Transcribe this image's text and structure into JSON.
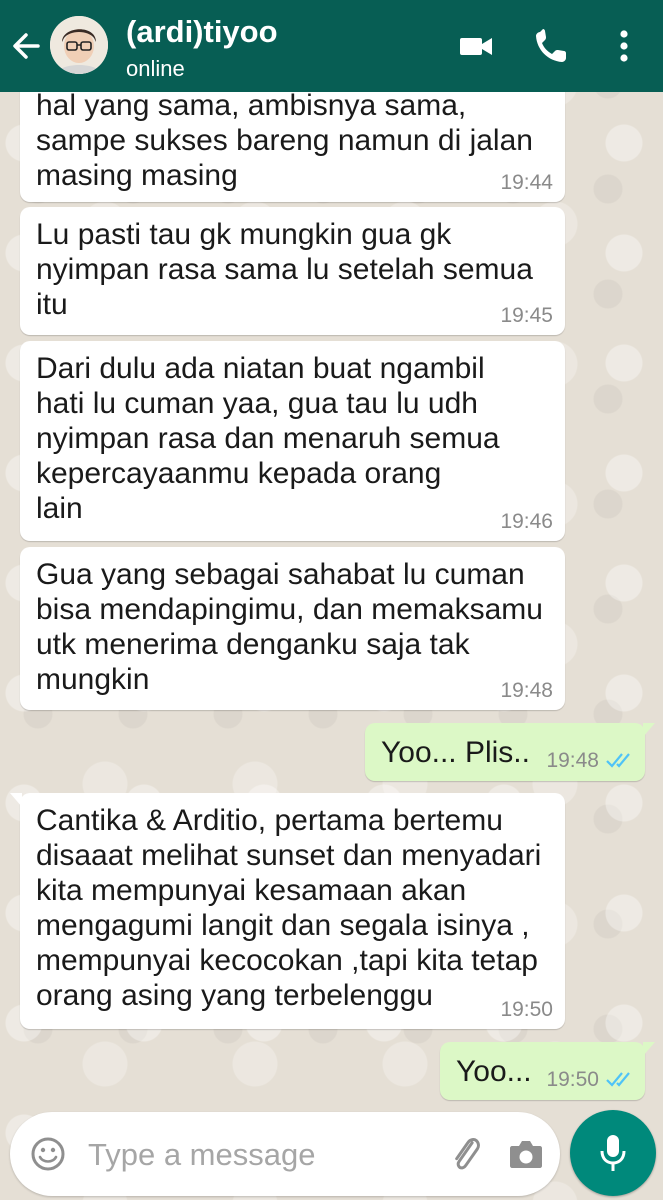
{
  "header": {
    "contact_name": "(ardi)tiyoo",
    "status": "online",
    "back_icon": "arrow-left-icon",
    "avatar": "contact-avatar",
    "icons": [
      "video-call-icon",
      "voice-call-icon",
      "more-vert-icon"
    ],
    "color": "#075e54"
  },
  "messages": [
    {
      "direction": "in",
      "text": "hal yang sama, ambisnya sama,\nsampe sukses bareng namun di jalan\nmasing masing",
      "time": "19:44"
    },
    {
      "direction": "in",
      "text": "Lu pasti tau gk mungkin gua gk\nnyimpan rasa sama lu setelah semua\nitu",
      "time": "19:45"
    },
    {
      "direction": "in",
      "text": "Dari dulu ada niatan buat ngambil\nhati lu cuman yaa, gua tau lu udh\nnyimpan rasa dan menaruh semua\nkepercayaanmu kepada orang\nlain",
      "time": "19:46"
    },
    {
      "direction": "in",
      "text": "Gua yang sebagai sahabat lu cuman\nbisa mendapingimu, dan memaksamu\nutk menerima denganku saja tak\nmungkin",
      "time": "19:48"
    },
    {
      "direction": "out",
      "text": "Yoo... Plis..",
      "time": "19:48",
      "status": "read"
    },
    {
      "direction": "in",
      "text": "Cantika & Arditio, pertama bertemu\ndisaaat melihat sunset dan menyadari\nkita mempunyai kesamaan akan\nmengagumi langit dan segala isinya ,\nmempunyai kecocokan ,tapi kita tetap\norang asing yang terbelenggu",
      "time": "19:50"
    },
    {
      "direction": "out",
      "text": "Yoo...",
      "time": "19:50",
      "status": "read"
    }
  ],
  "input": {
    "placeholder": "Type a message",
    "value": "",
    "icons": [
      "emoji-icon",
      "attach-icon",
      "camera-icon",
      "mic-icon"
    ]
  },
  "colors": {
    "incoming_bubble": "#ffffff",
    "outgoing_bubble": "#dcf8c6",
    "read_ticks": "#4fc3f7",
    "mic_button": "#00897b"
  }
}
